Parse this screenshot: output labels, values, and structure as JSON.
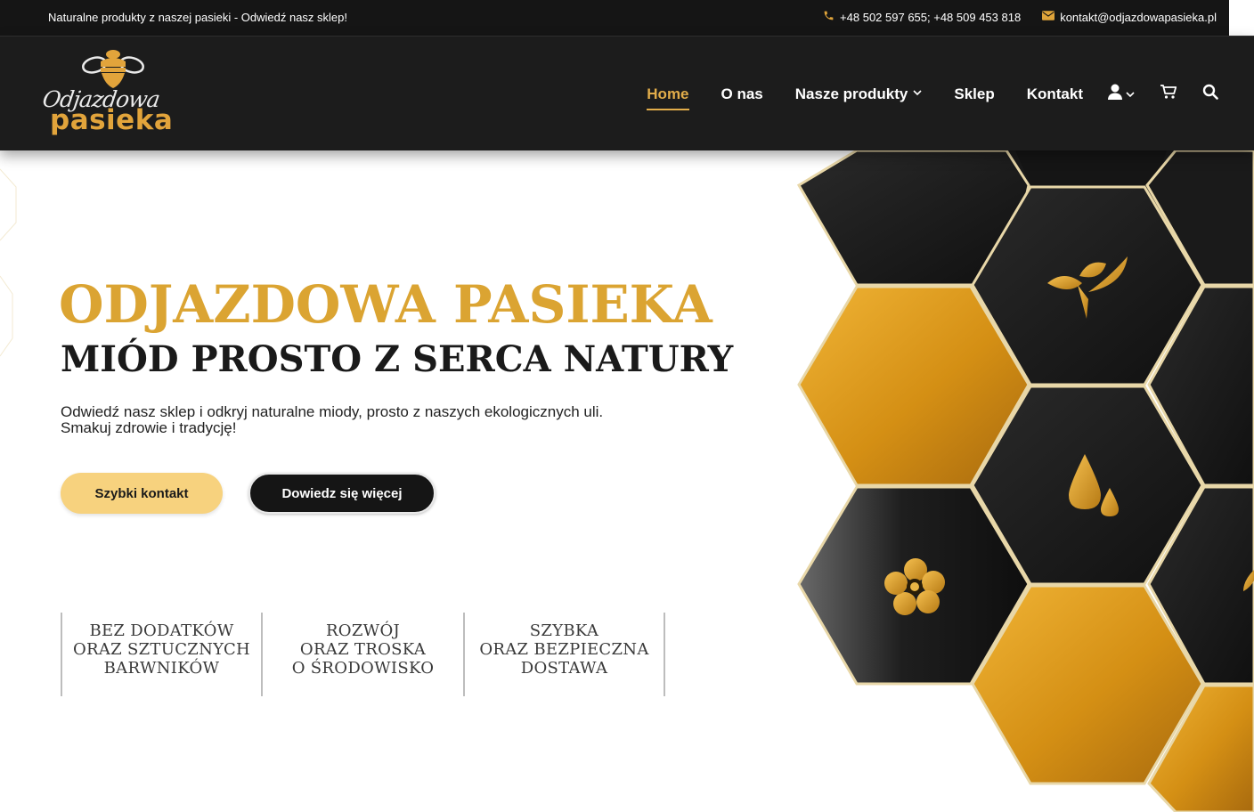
{
  "topbar": {
    "promo": "Naturalne produkty z naszej pasieki - Odwiedź nasz sklep!",
    "phone": "+48 502 597 655; +48 509 453 818",
    "email": "kontakt@odjazdowapasieka.pl",
    "phone_icon": "phone-icon",
    "email_icon": "envelope-icon"
  },
  "logo": {
    "script": "Odjazdowa",
    "word": "pasieka"
  },
  "nav": {
    "items": [
      {
        "label": "Home",
        "active": true
      },
      {
        "label": "O nas"
      },
      {
        "label": "Nasze produkty",
        "has_dropdown": true
      },
      {
        "label": "Sklep"
      },
      {
        "label": "Kontakt"
      }
    ],
    "icons": [
      "user-icon",
      "cart-icon",
      "search-icon"
    ]
  },
  "hero": {
    "title": "ODJAZDOWA PASIEKA",
    "subtitle": "MIÓD PROSTO Z SERCA NATURY",
    "desc_line1": "Odwiedź nasz sklep i odkryj naturalne miody, prosto z naszych ekologicznych uli.",
    "desc_line2": "Smakuj zdrowie i tradycję!",
    "primary_button": "Szybki kontakt",
    "secondary_button": "Dowiedz się więcej"
  },
  "features": [
    {
      "line1": "BEZ DODATKÓW",
      "line2": "ORAZ SZTUCZNYCH",
      "line3": "BARWNIKÓW"
    },
    {
      "line1": "ROZWÓJ",
      "line2": "ORAZ TROSKA",
      "line3": "O ŚRODOWISKO"
    },
    {
      "line1": "SZYBKA",
      "line2": "ORAZ BEZPIECZNA",
      "line3": "DOSTAWA"
    }
  ],
  "honeycomb_icons": [
    "leaves-icon",
    "honey-drop-icon",
    "flower-icon"
  ],
  "colors": {
    "gold": "#dba432",
    "gold_light": "#f7d27e",
    "dark": "#1c1c1c",
    "nav_active": "#e2ad4a"
  }
}
